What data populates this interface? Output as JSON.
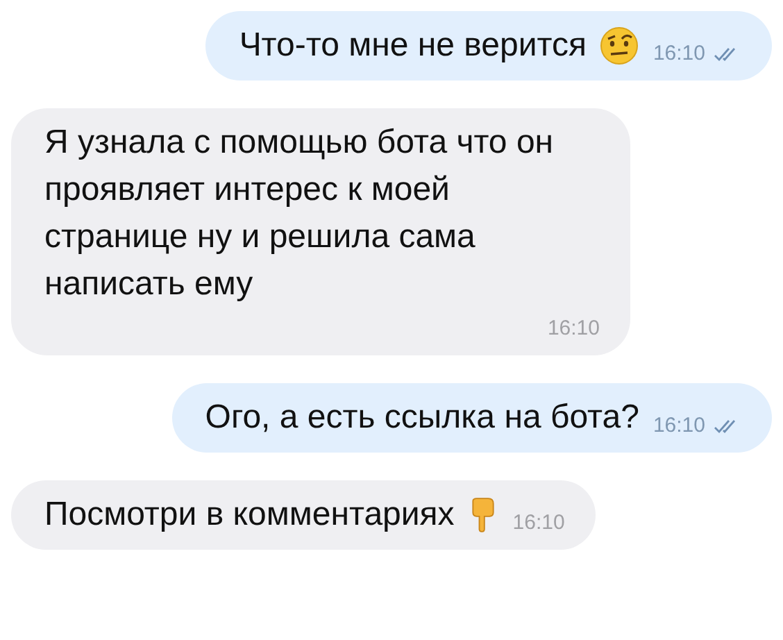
{
  "messages": [
    {
      "kind": "outgoing",
      "text": "Что-то мне не верится",
      "emoji": {
        "kind": "face"
      },
      "time": "16:10",
      "read": true
    },
    {
      "kind": "incoming",
      "text": "Я узнала с помощью бота что он проявляет интерес к моей странице ну и решила сама написать ему",
      "time": "16:10"
    },
    {
      "kind": "outgoing",
      "text": "Ого, а есть ссылка на бота?",
      "time": "16:10",
      "read": true
    },
    {
      "kind": "incoming",
      "text": "Посмотри в комментариях",
      "emoji": {
        "kind": "hand"
      },
      "time": "16:10"
    }
  ]
}
